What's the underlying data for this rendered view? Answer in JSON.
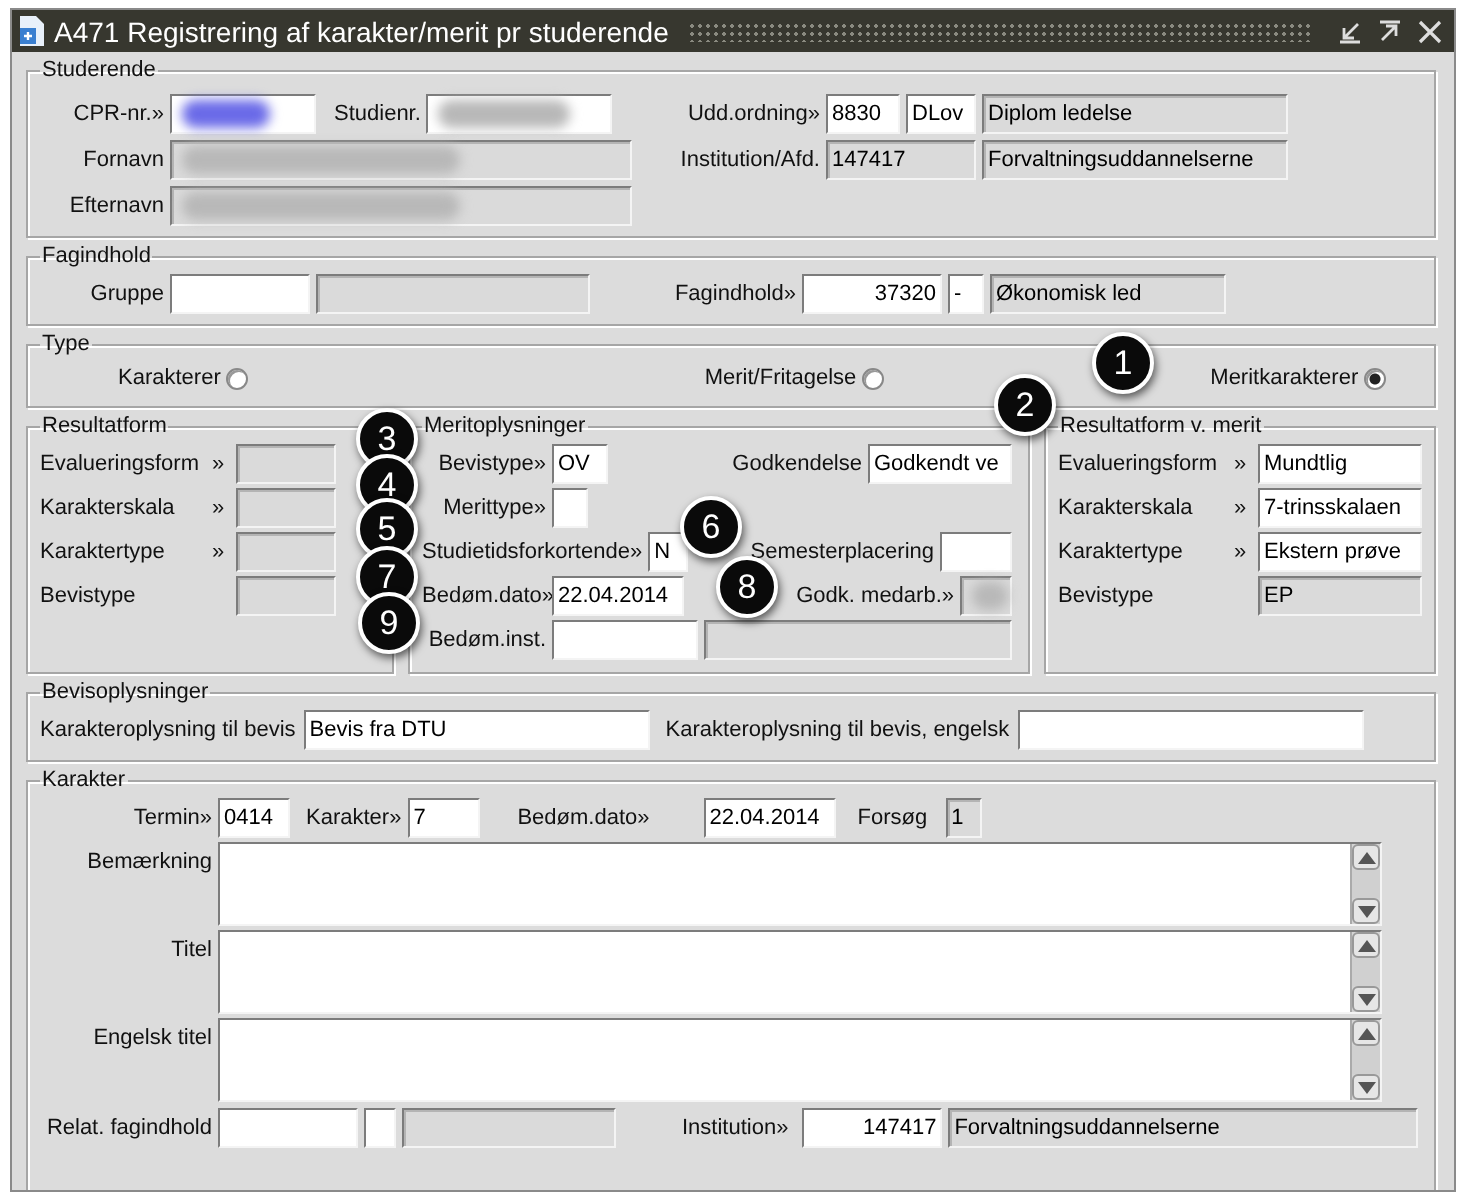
{
  "window": {
    "title": "A471 Registrering af karakter/merit pr studerende"
  },
  "studerende": {
    "title": "Studerende",
    "cpr": {
      "label": "CPR-nr.»",
      "readonly": false
    },
    "studienr": {
      "label": "Studienr.",
      "readonly": false
    },
    "fornavn": {
      "label": "Fornavn",
      "readonly": true
    },
    "efternavn": {
      "label": "Efternavn",
      "readonly": true
    },
    "udd_ordning": {
      "label": "Udd.ordning»",
      "code": "8830",
      "short": "DLov",
      "name": "Diplom ledelse"
    },
    "institution": {
      "label": "Institution/Afd.",
      "code": "147417",
      "name": "Forvaltningsuddannelserne"
    }
  },
  "fagindhold": {
    "title": "Fagindhold",
    "gruppe": {
      "label": "Gruppe"
    },
    "fag": {
      "label": "Fagindhold»",
      "code": "37320",
      "dash": "-",
      "name": "Økonomisk led"
    }
  },
  "type": {
    "title": "Type",
    "options": [
      {
        "label": "Karakterer",
        "selected": false
      },
      {
        "label": "Merit/Fritagelse",
        "selected": false
      },
      {
        "label": "Meritkarakterer",
        "selected": true
      }
    ]
  },
  "resultatform": {
    "title": "Resultatform",
    "rows": [
      {
        "label": "Evalueringsform",
        "arrow": "»"
      },
      {
        "label": "Karakterskala",
        "arrow": "»"
      },
      {
        "label": "Karaktertype",
        "arrow": "»"
      },
      {
        "label": "Bevistype"
      }
    ]
  },
  "meritoplysninger": {
    "title": "Meritoplysninger",
    "bevistype": {
      "label": "Bevistype»",
      "value": "OV"
    },
    "godkendelse": {
      "label": "Godkendelse",
      "value": "Godkendt ve"
    },
    "merittype": {
      "label": "Merittype»"
    },
    "studietid": {
      "label": "Studietidsforkortende»",
      "value": "N"
    },
    "semester": {
      "label": "Semesterplacering"
    },
    "bedom_dato": {
      "label": "Bedøm.dato»",
      "value": "22.04.2014"
    },
    "godk_medarb": {
      "label": "Godk. medarb.»"
    },
    "bedom_inst": {
      "label": "Bedøm.inst."
    }
  },
  "resultatform_merit": {
    "title": "Resultatform v. merit",
    "rows": [
      {
        "label": "Evalueringsform",
        "arrow": "»",
        "value": "Mundtlig",
        "readonly": false
      },
      {
        "label": "Karakterskala",
        "arrow": "»",
        "value": "7-trinsskalaen",
        "readonly": false
      },
      {
        "label": "Karaktertype",
        "arrow": "»",
        "value": "Ekstern prøve",
        "readonly": false
      },
      {
        "label": "Bevistype",
        "value": "EP",
        "readonly": true
      }
    ]
  },
  "bevis": {
    "title": "Bevisoplysninger",
    "fields": [
      {
        "label": "Karakteroplysning til bevis",
        "value": "Bevis fra DTU"
      },
      {
        "label": "Karakteroplysning til bevis, engelsk"
      }
    ]
  },
  "karakter": {
    "title": "Karakter",
    "termin": {
      "label": "Termin»",
      "value": "0414"
    },
    "karakter": {
      "label": "Karakter»",
      "value": "7"
    },
    "bedom_dato": {
      "label": "Bedøm.dato»",
      "value": "22.04.2014"
    },
    "forsoeg": {
      "label": "Forsøg",
      "value": "1"
    },
    "textareas": [
      {
        "label": "Bemærkning"
      },
      {
        "label": "Titel"
      },
      {
        "label": "Engelsk titel"
      }
    ],
    "relat": {
      "label": "Relat. fagindhold"
    },
    "institution": {
      "label": "Institution»",
      "code": "147417",
      "name": "Forvaltningsuddannelserne"
    }
  },
  "callouts": [
    "1",
    "2",
    "3",
    "4",
    "5",
    "6",
    "7",
    "8",
    "9"
  ]
}
